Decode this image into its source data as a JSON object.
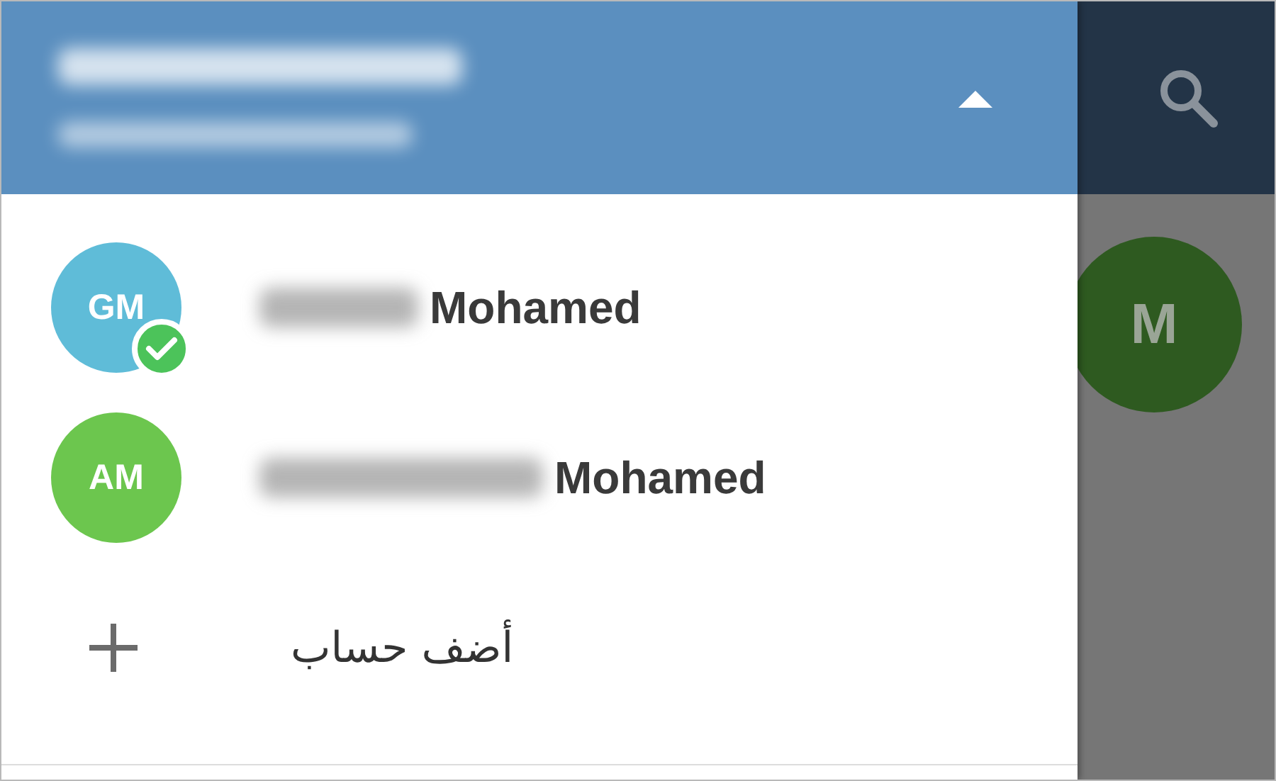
{
  "header": {
    "expanded": true
  },
  "accounts": [
    {
      "initials": "GM",
      "color": "#5fbcd8",
      "name": "Mohamed",
      "selected": true
    },
    {
      "initials": "AM",
      "color": "#6cc64e",
      "name": "Mohamed",
      "selected": false
    }
  ],
  "add_account": {
    "label": "أضف حساب"
  },
  "background_chat": {
    "initials": "M",
    "color": "#2e5a20"
  }
}
